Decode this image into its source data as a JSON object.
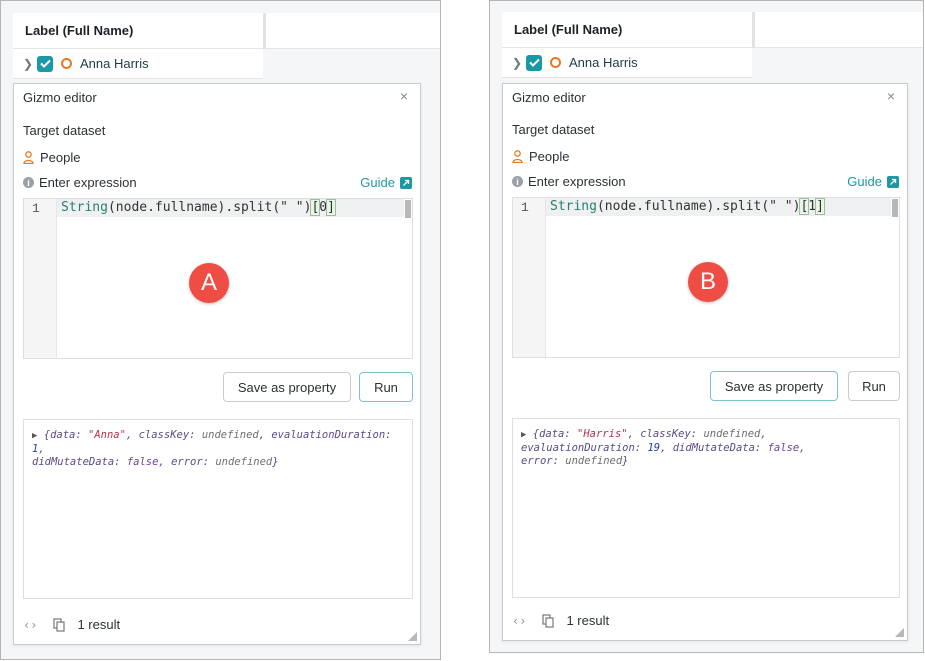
{
  "panels": [
    {
      "column_header": "Label (Full Name)",
      "row_name": "Anna Harris",
      "editor_title": "Gizmo editor",
      "close_glyph": "×",
      "target_dataset_label": "Target dataset",
      "dataset_name": "People",
      "enter_expression_label": "Enter expression",
      "guide_label": "Guide",
      "line_number": "1",
      "code_prefix": "String",
      "code_middle": "(node.fullname).split(\" \")",
      "code_open": "[",
      "code_index": "0",
      "code_close": "]",
      "marker": "A",
      "save_label": "Save as property",
      "run_label": "Run",
      "output": {
        "p1": "{data: ",
        "data": "\"Anna\"",
        "p2": ", classKey: ",
        "classKey": "undefined",
        "p3": ", evaluationDuration: ",
        "duration": "1",
        "p4": ",",
        "p5": "didMutateData: ",
        "didMutate": "false",
        "p6": ", error: ",
        "error": "undefined",
        "p7": "}"
      },
      "result_count": "1 result"
    },
    {
      "column_header": "Label (Full Name)",
      "row_name": "Anna Harris",
      "editor_title": "Gizmo editor",
      "close_glyph": "×",
      "target_dataset_label": "Target dataset",
      "dataset_name": "People",
      "enter_expression_label": "Enter expression",
      "guide_label": "Guide",
      "line_number": "1",
      "code_prefix": "String",
      "code_middle": "(node.fullname).split(\" \")",
      "code_open": "[",
      "code_index": "1",
      "code_close": "]",
      "marker": "B",
      "save_label": "Save as property",
      "run_label": "Run",
      "output": {
        "p1": "{data: ",
        "data": "\"Harris\"",
        "p2": ", classKey: ",
        "classKey": "undefined",
        "p3": ",",
        "p4": "evaluationDuration: ",
        "duration": "19",
        "p5": ", didMutateData: ",
        "didMutate": "false",
        "p6": ",",
        "p7": "error: ",
        "error": "undefined",
        "p8": "}"
      },
      "result_count": "1 result"
    }
  ],
  "colors": {
    "accent": "#1b98a6",
    "node_orange": "#e67a23",
    "marker_red": "#ef4c43"
  },
  "icons": {
    "chevron": "chevron-right-icon",
    "checkbox": "checked-checkbox-icon",
    "node": "node-circle-icon",
    "person": "person-icon",
    "info": "info-icon",
    "external": "external-link-icon",
    "braces": "code-braces-icon",
    "copy": "copy-icon",
    "resize": "resize-handle-icon"
  }
}
